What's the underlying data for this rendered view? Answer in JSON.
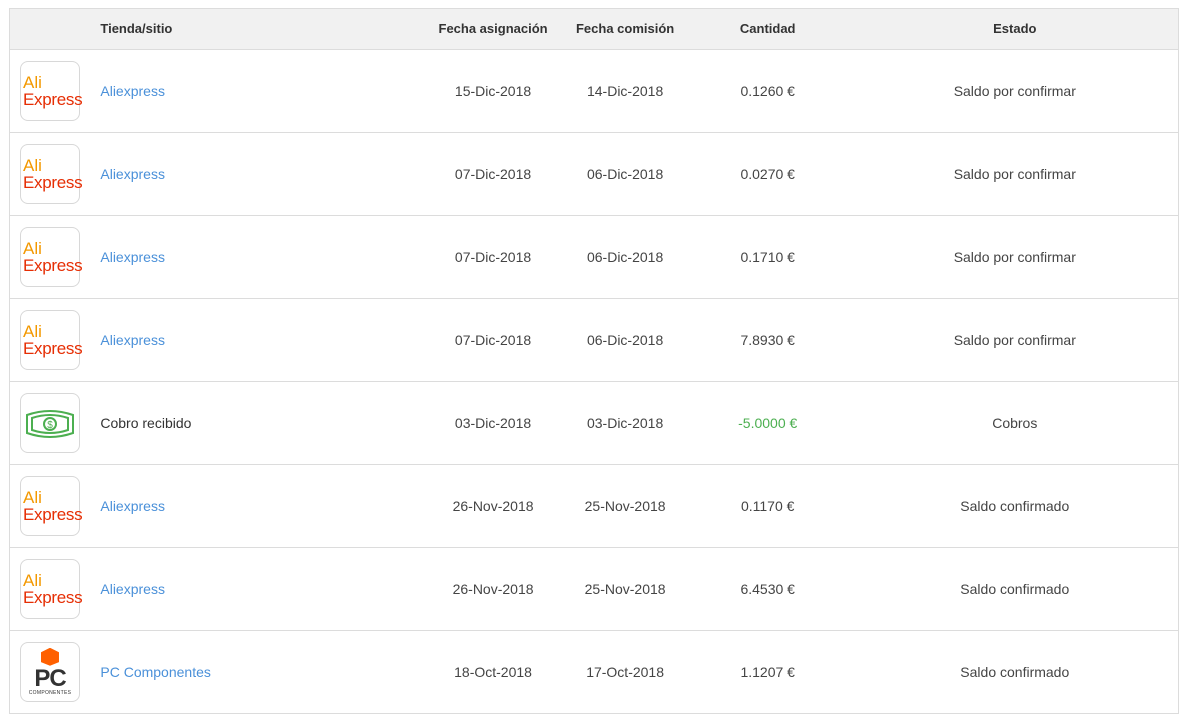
{
  "headers": {
    "store": "Tienda/sitio",
    "assign_date": "Fecha asignación",
    "commission_date": "Fecha comisión",
    "amount": "Cantidad",
    "status": "Estado"
  },
  "logos": {
    "aliexpress": {
      "line1": "Ali",
      "line2": "Express"
    },
    "pc": {
      "main": "PC",
      "sub": "COMPONENTES"
    }
  },
  "colors": {
    "link": "#4a90d9",
    "negative_amount": "#4caf50",
    "header_bg": "#f1f1f1",
    "ali_orange": "#f39800",
    "ali_red": "#e62e04",
    "pc_orange": "#ff6000"
  },
  "rows": [
    {
      "logo": "aliexpress",
      "store": "Aliexpress",
      "link": true,
      "assign": "15-Dic-2018",
      "commission": "14-Dic-2018",
      "amount": "0.1260 €",
      "status": "Saldo por confirmar"
    },
    {
      "logo": "aliexpress",
      "store": "Aliexpress",
      "link": true,
      "assign": "07-Dic-2018",
      "commission": "06-Dic-2018",
      "amount": "0.0270 €",
      "status": "Saldo por confirmar"
    },
    {
      "logo": "aliexpress",
      "store": "Aliexpress",
      "link": true,
      "assign": "07-Dic-2018",
      "commission": "06-Dic-2018",
      "amount": "0.1710 €",
      "status": "Saldo por confirmar"
    },
    {
      "logo": "aliexpress",
      "store": "Aliexpress",
      "link": true,
      "assign": "07-Dic-2018",
      "commission": "06-Dic-2018",
      "amount": "7.8930 €",
      "status": "Saldo por confirmar"
    },
    {
      "logo": "money",
      "store": "Cobro recibido",
      "link": false,
      "assign": "03-Dic-2018",
      "commission": "03-Dic-2018",
      "amount": "-5.0000 €",
      "status": "Cobros"
    },
    {
      "logo": "aliexpress",
      "store": "Aliexpress",
      "link": true,
      "assign": "26-Nov-2018",
      "commission": "25-Nov-2018",
      "amount": "0.1170 €",
      "status": "Saldo confirmado"
    },
    {
      "logo": "aliexpress",
      "store": "Aliexpress",
      "link": true,
      "assign": "26-Nov-2018",
      "commission": "25-Nov-2018",
      "amount": "6.4530 €",
      "status": "Saldo confirmado"
    },
    {
      "logo": "pc",
      "store": "PC Componentes",
      "link": true,
      "assign": "18-Oct-2018",
      "commission": "17-Oct-2018",
      "amount": "1.1207 €",
      "status": "Saldo confirmado"
    }
  ]
}
